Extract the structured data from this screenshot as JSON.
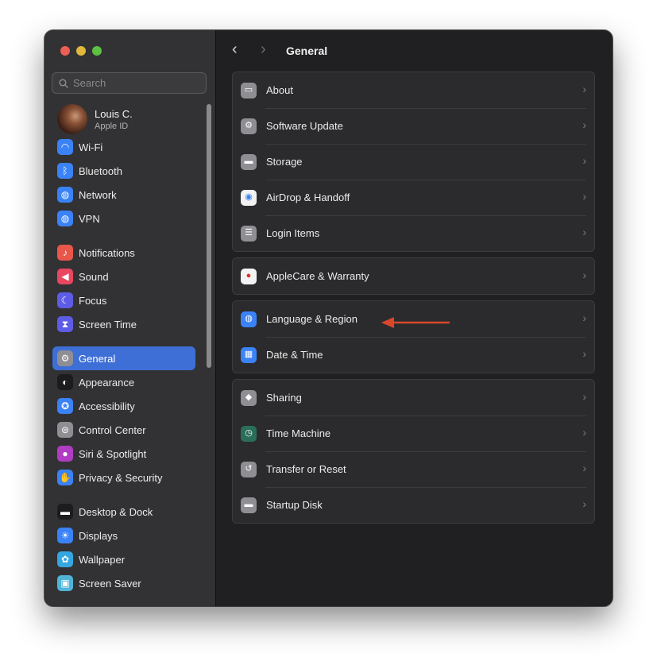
{
  "sidebar": {
    "search_placeholder": "Search",
    "profile": {
      "name": "Louis C.",
      "subtitle": "Apple ID"
    },
    "items": [
      {
        "label": "Wi-Fi",
        "icon": "wifi-icon",
        "color": "#3a82f6"
      },
      {
        "label": "Bluetooth",
        "icon": "bluetooth-icon",
        "color": "#3a82f6"
      },
      {
        "label": "Network",
        "icon": "globe-icon",
        "color": "#3a82f6"
      },
      {
        "label": "VPN",
        "icon": "vpn-icon",
        "color": "#3a82f6"
      },
      {
        "label": "Notifications",
        "icon": "bell-icon",
        "color": "#e9574b"
      },
      {
        "label": "Sound",
        "icon": "speaker-icon",
        "color": "#e9465f"
      },
      {
        "label": "Focus",
        "icon": "moon-icon",
        "color": "#5e5ce6"
      },
      {
        "label": "Screen Time",
        "icon": "hourglass-icon",
        "color": "#5e5ce6"
      },
      {
        "label": "General",
        "icon": "gear-icon",
        "color": "#8e8e93",
        "active": true
      },
      {
        "label": "Appearance",
        "icon": "appearance-icon",
        "color": "#1c1c1e"
      },
      {
        "label": "Accessibility",
        "icon": "accessibility-icon",
        "color": "#3a82f6"
      },
      {
        "label": "Control Center",
        "icon": "toggles-icon",
        "color": "#8e8e93"
      },
      {
        "label": "Siri & Spotlight",
        "icon": "siri-icon",
        "color": "#b03cc2"
      },
      {
        "label": "Privacy & Security",
        "icon": "hand-icon",
        "color": "#3a82f6"
      },
      {
        "label": "Desktop & Dock",
        "icon": "dock-icon",
        "color": "#1c1c1e"
      },
      {
        "label": "Displays",
        "icon": "sun-icon",
        "color": "#3a82f6"
      },
      {
        "label": "Wallpaper",
        "icon": "flower-icon",
        "color": "#35a7e0"
      },
      {
        "label": "Screen Saver",
        "icon": "screensaver-icon",
        "color": "#4fb4d8"
      }
    ]
  },
  "main": {
    "title": "General",
    "groups": [
      [
        {
          "label": "About",
          "icon": "laptop-icon",
          "color": "#8e8e93"
        },
        {
          "label": "Software Update",
          "icon": "gear-badge-icon",
          "color": "#8e8e93"
        },
        {
          "label": "Storage",
          "icon": "drive-icon",
          "color": "#8e8e93"
        },
        {
          "label": "AirDrop & Handoff",
          "icon": "airdrop-icon",
          "color": "#f2f2f2"
        },
        {
          "label": "Login Items",
          "icon": "list-icon",
          "color": "#8e8e93"
        }
      ],
      [
        {
          "label": "AppleCare & Warranty",
          "icon": "apple-icon",
          "color": "#f2f2f2"
        }
      ],
      [
        {
          "label": "Language & Region",
          "icon": "globe-icon",
          "color": "#3a82f6"
        },
        {
          "label": "Date & Time",
          "icon": "calendar-clock-icon",
          "color": "#3a82f6"
        }
      ],
      [
        {
          "label": "Sharing",
          "icon": "sharing-icon",
          "color": "#8e8e93"
        },
        {
          "label": "Time Machine",
          "icon": "time-machine-icon",
          "color": "#2a6e5a"
        },
        {
          "label": "Transfer or Reset",
          "icon": "reset-icon",
          "color": "#8e8e93"
        },
        {
          "label": "Startup Disk",
          "icon": "disk-icon",
          "color": "#8e8e93"
        }
      ]
    ]
  },
  "annotation": {
    "arrow_color": "#d9472b"
  }
}
